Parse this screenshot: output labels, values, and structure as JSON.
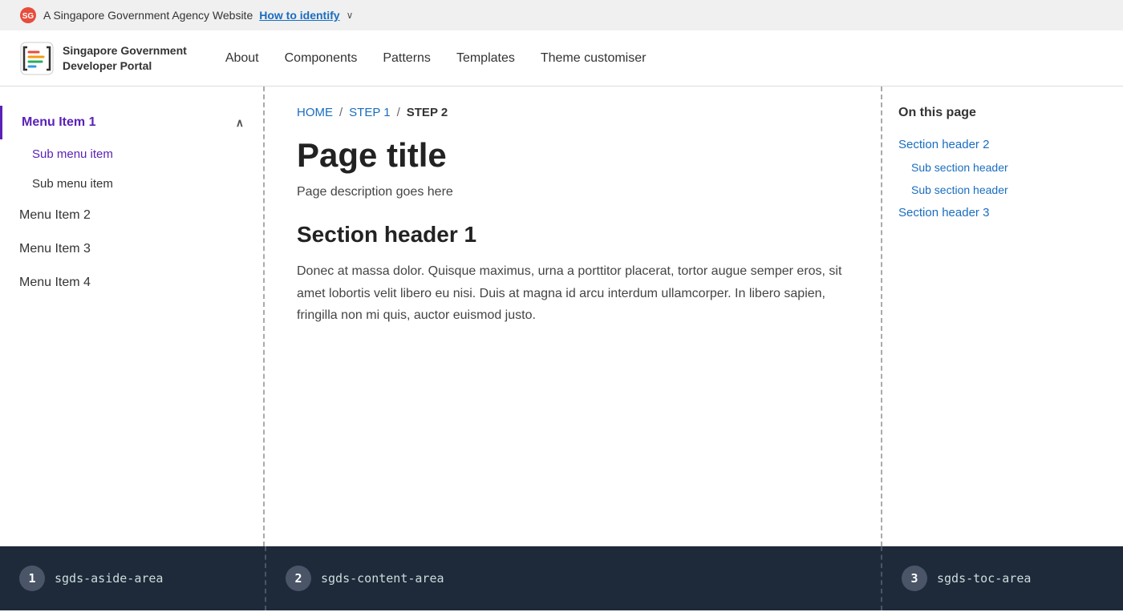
{
  "govBanner": {
    "text": "A Singapore Government Agency Website",
    "linkText": "How to identify",
    "chevron": "∨"
  },
  "navbar": {
    "brandName": "Singapore Government\nDeveloper Portal",
    "links": [
      {
        "label": "About",
        "href": "#"
      },
      {
        "label": "Components",
        "href": "#"
      },
      {
        "label": "Patterns",
        "href": "#"
      },
      {
        "label": "Templates",
        "href": "#"
      },
      {
        "label": "Theme customiser",
        "href": "#"
      }
    ]
  },
  "sidebar": {
    "items": [
      {
        "label": "Menu Item 1",
        "active": true,
        "expanded": true,
        "subItems": [
          {
            "label": "Sub menu item",
            "active": true
          },
          {
            "label": "Sub menu item",
            "active": false
          }
        ]
      },
      {
        "label": "Menu Item 2"
      },
      {
        "label": "Menu Item 3"
      },
      {
        "label": "Menu Item 4"
      }
    ]
  },
  "breadcrumb": {
    "items": [
      {
        "label": "HOME",
        "href": "#",
        "isCurrent": false
      },
      {
        "label": "STEP 1",
        "href": "#",
        "isCurrent": false
      },
      {
        "label": "STEP 2",
        "isCurrent": true
      }
    ]
  },
  "content": {
    "pageTitle": "Page title",
    "pageDescription": "Page description goes here",
    "sectionHeader": "Section header 1",
    "sectionBody": "Donec at massa dolor. Quisque maximus, urna a porttitor placerat, tortor augue semper eros, sit amet lobortis velit libero eu nisi. Duis at magna id arcu interdum ullamcorper. In libero sapien, fringilla non mi quis, auctor euismod justo."
  },
  "toc": {
    "title": "On this page",
    "links": [
      {
        "label": "Section header 2",
        "sub": false
      },
      {
        "label": "Sub section header",
        "sub": true
      },
      {
        "label": "Sub section header",
        "sub": true
      },
      {
        "label": "Section header 3",
        "sub": false
      }
    ]
  },
  "annotations": {
    "aside": "sgds-aside-area",
    "content": "sgds-content-area",
    "toc": "sgds-toc-area"
  }
}
